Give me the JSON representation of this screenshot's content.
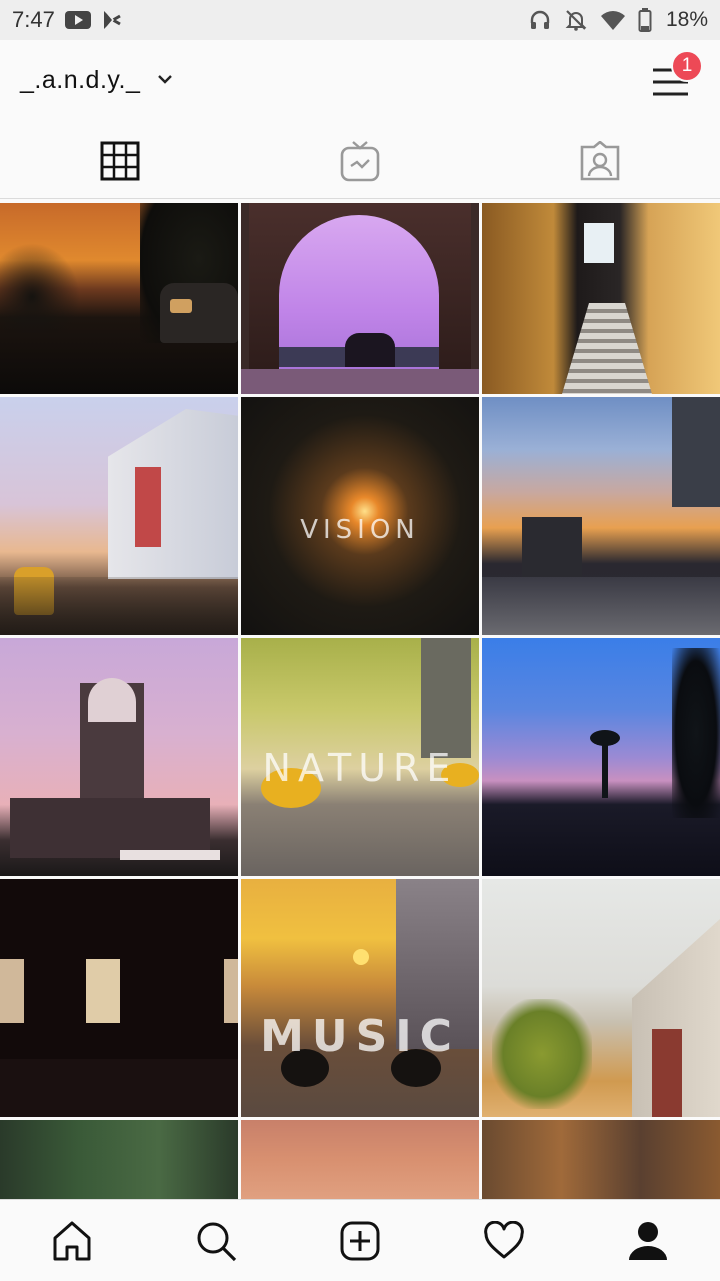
{
  "status_bar": {
    "time": "7:47",
    "left_icons": [
      "youtube-icon",
      "play-store-icon"
    ],
    "right_icons": [
      "headphones-icon",
      "notifications-off-icon",
      "wifi-icon",
      "battery-icon"
    ],
    "battery": "18%"
  },
  "header": {
    "username": "_.a.n.d.y._",
    "notification_count": "1",
    "badge_color": "#ed4956"
  },
  "tabs": [
    {
      "name": "grid-tab",
      "icon": "grid-icon",
      "active": true
    },
    {
      "name": "igtv-tab",
      "icon": "igtv-icon",
      "active": false
    },
    {
      "name": "tagged-tab",
      "icon": "tagged-photos-icon",
      "active": false
    }
  ],
  "posts": [
    {
      "subject": "sunset street with cars",
      "text": ""
    },
    {
      "subject": "purple sky through arch",
      "text": ""
    },
    {
      "subject": "narrow stairway with wheat",
      "text": ""
    },
    {
      "subject": "mall street market",
      "text": ""
    },
    {
      "subject": "sunburst through trees",
      "text": "VISION"
    },
    {
      "subject": "sunset sky over road",
      "text": ""
    },
    {
      "subject": "clock tower at dusk",
      "text": ""
    },
    {
      "subject": "flowers on ground",
      "text": "NATURE"
    },
    {
      "subject": "palm trees at dusk",
      "text": ""
    },
    {
      "subject": "dark room with windows",
      "text": ""
    },
    {
      "subject": "earphones at sunset",
      "text": "MUSIC"
    },
    {
      "subject": "college building with trees",
      "text": ""
    },
    {
      "subject": "trees",
      "text": ""
    },
    {
      "subject": "orange sky",
      "text": ""
    },
    {
      "subject": "autumn trees",
      "text": ""
    }
  ],
  "bottom_nav": [
    {
      "name": "nav-home",
      "icon": "home-icon"
    },
    {
      "name": "nav-search",
      "icon": "search-icon"
    },
    {
      "name": "nav-add",
      "icon": "add-post-icon"
    },
    {
      "name": "nav-activity",
      "icon": "heart-icon"
    },
    {
      "name": "nav-profile",
      "icon": "profile-icon",
      "active": true
    }
  ]
}
